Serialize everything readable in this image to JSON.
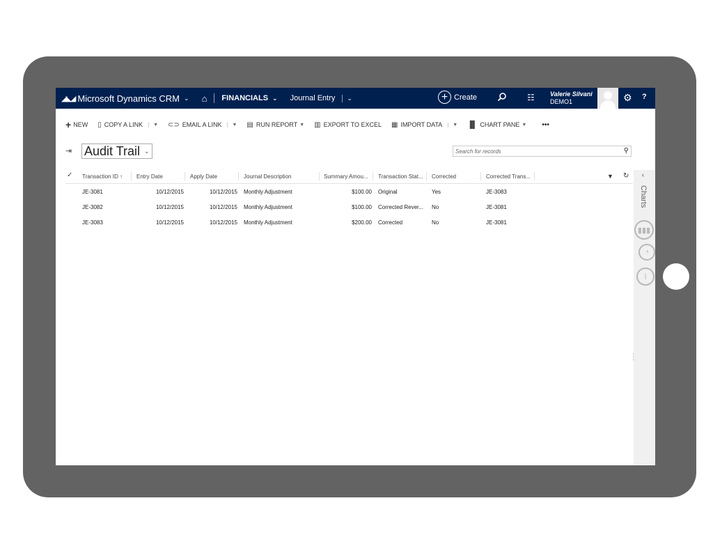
{
  "navbar": {
    "app_name": "Microsoft Dynamics CRM",
    "area": "FINANCIALS",
    "entity": "Journal Entry",
    "create_label": "Create",
    "user_name": "Valerie Silvani",
    "org": "DEMO1",
    "help_label": "?"
  },
  "commands": {
    "new": "NEW",
    "copy_link": "COPY A LINK",
    "email_link": "EMAIL A LINK",
    "run_report": "RUN REPORT",
    "export_excel": "EXPORT TO EXCEL",
    "import_data": "IMPORT DATA",
    "chart_pane": "CHART PANE",
    "more": "•••"
  },
  "view": {
    "title": "Audit Trail",
    "search_placeholder": "Search for records"
  },
  "grid": {
    "columns": [
      "Transaction ID ↑",
      "Entry Date",
      "Apply Date",
      "Journal Description",
      "Summary Amou...",
      "Transaction Stat...",
      "Corrected",
      "Corrected Trans..."
    ],
    "rows": [
      [
        "JE-3081",
        "10/12/2015",
        "10/12/2015",
        "Monthly Adjustment",
        "$100.00",
        "Original",
        "Yes",
        "JE-3083"
      ],
      [
        "JE-3082",
        "10/12/2015",
        "10/12/2015",
        "Monthly Adjustment",
        "$100.00",
        "Corrected Rever...",
        "No",
        "JE-3081"
      ],
      [
        "JE-3083",
        "10/12/2015",
        "10/12/2015",
        "Monthly Adjustment",
        "$200.00",
        "Corrected",
        "No",
        "JE-3081"
      ]
    ]
  },
  "charts_pane": {
    "label": "Charts"
  }
}
